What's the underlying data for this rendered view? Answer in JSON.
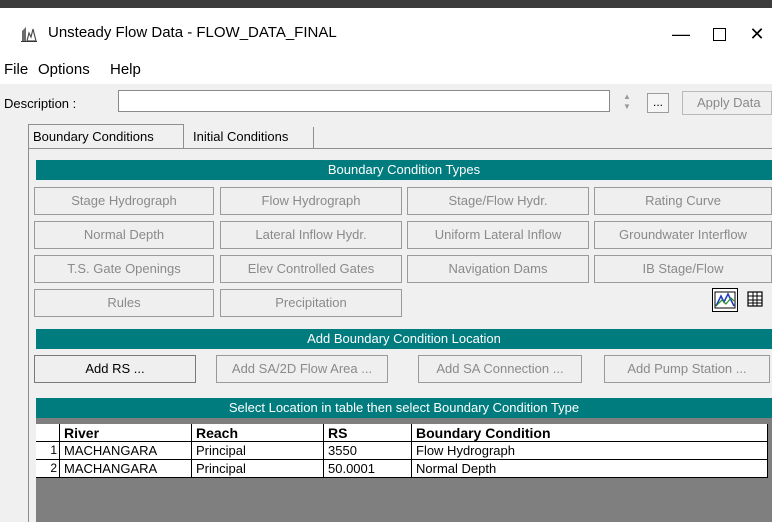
{
  "window": {
    "title": "Unsteady Flow Data - FLOW_DATA_FINAL",
    "minimize_glyph": "—",
    "maximize_glyph": "☐",
    "close_glyph": "✕",
    "app_icon": "hec-ras-unsteady-icon"
  },
  "menu": [
    "File",
    "Options",
    "Help"
  ],
  "description": {
    "label": "Description :",
    "value": "",
    "more_label": "...",
    "apply_label": "Apply Data"
  },
  "tabs": [
    "Boundary Conditions",
    "Initial Conditions"
  ],
  "bc_types": {
    "header": "Boundary Condition Types",
    "buttons": [
      "Stage Hydrograph",
      "Flow Hydrograph",
      "Stage/Flow Hydr.",
      "Rating Curve",
      "Normal Depth",
      "Lateral Inflow Hydr.",
      "Uniform Lateral Inflow",
      "Groundwater Interflow",
      "T.S. Gate Openings",
      "Elev Controlled Gates",
      "Navigation Dams",
      "IB Stage/Flow",
      "Rules",
      "Precipitation"
    ],
    "plot_icon": "hydrograph-plot-icon",
    "table_icon": "table-grid-icon"
  },
  "add_location": {
    "header": "Add Boundary Condition Location",
    "buttons": [
      "Add RS ...",
      "Add SA/2D Flow Area ...",
      "Add SA Connection ...",
      "Add Pump Station ..."
    ]
  },
  "table": {
    "header": "Select Location in table then select Boundary Condition Type",
    "columns": [
      "River",
      "Reach",
      "RS",
      "Boundary Condition"
    ],
    "rows": [
      {
        "num": "1",
        "river": "MACHANGARA",
        "reach": "Principal",
        "rs": "3550",
        "bc": "Flow Hydrograph"
      },
      {
        "num": "2",
        "river": "MACHANGARA",
        "reach": "Principal",
        "rs": "50.0001",
        "bc": "Normal Depth"
      }
    ]
  },
  "colors": {
    "accent": "#007c7f",
    "disabled_text": "#8a8a8a",
    "grid_empty": "#7f7f7f"
  }
}
